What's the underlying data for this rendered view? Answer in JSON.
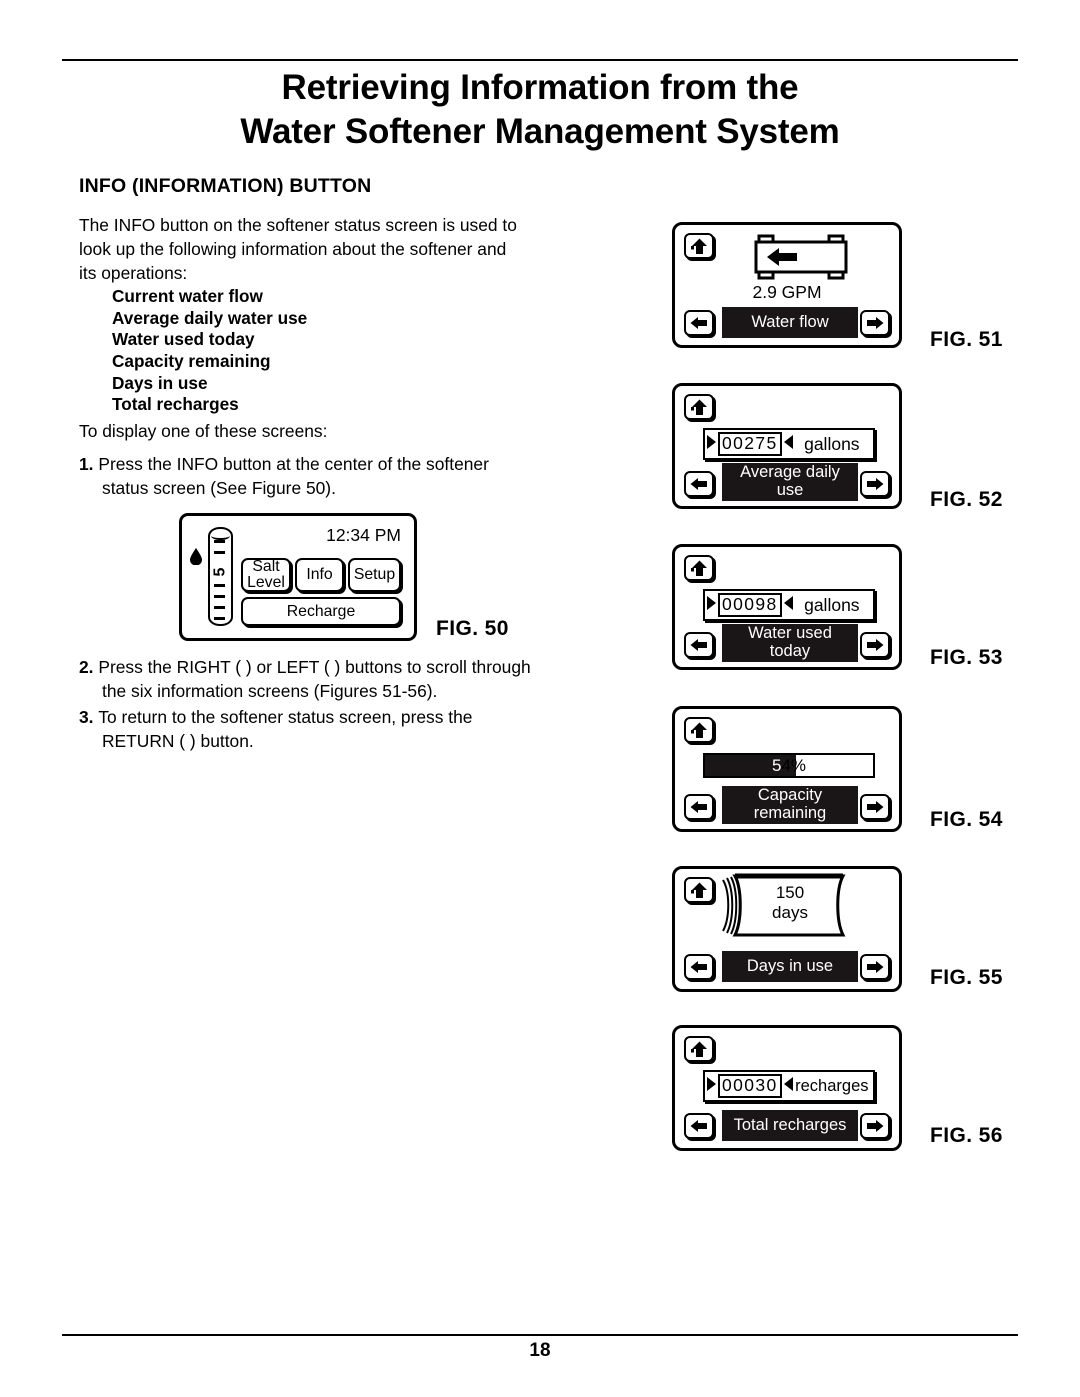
{
  "document": {
    "title_line1": "Retrieving Information from the",
    "title_line2": "Water Softener Management System",
    "section_heading": "INFO (INFORMATION) BUTTON",
    "page_number": "18"
  },
  "body": {
    "intro": "The INFO button on the softener status screen is used to look up the following information about the softener and its operations:",
    "info_items": [
      "Current water flow",
      "Average daily water use",
      "Water used today",
      "Capacity remaining",
      "Days in use",
      "Total recharges"
    ],
    "lead_in": "To display one of these screens:",
    "steps": [
      {
        "num": "1.",
        "text": "Press the INFO button at the center of the softener status screen (See Figure 50)."
      },
      {
        "num": "2.",
        "text": "Press the RIGHT (   ) or LEFT (   ) buttons to scroll through the six information screens (Figures 51-56)."
      },
      {
        "num": "3.",
        "text": "To return to the softener status screen, press the RETURN (   ) button."
      }
    ]
  },
  "figures": {
    "fig50": {
      "label": "FIG. 50",
      "clock": "12:34 PM",
      "salt_gauge_value": "5",
      "buttons": {
        "salt_line1": "Salt",
        "salt_line2": "Level",
        "info": "Info",
        "setup": "Setup",
        "recharge": "Recharge"
      }
    },
    "fig51": {
      "label": "FIG. 51",
      "value": "2.9 GPM",
      "caption": "Water flow",
      "glyph": "pipe-flow-icon"
    },
    "fig52": {
      "label": "FIG. 52",
      "value": "00275",
      "unit": "gallons",
      "caption_line1": "Average daily",
      "caption_line2": "use"
    },
    "fig53": {
      "label": "FIG. 53",
      "value": "00098",
      "unit": "gallons",
      "caption_line1": "Water used",
      "caption_line2": "today"
    },
    "fig54": {
      "label": "FIG. 54",
      "value_filled": "5",
      "value_rest": "4%",
      "percent": 54,
      "caption_line1": "Capacity",
      "caption_line2": "remaining"
    },
    "fig55": {
      "label": "FIG. 55",
      "value": "150",
      "unit": "days",
      "caption": "Days in use"
    },
    "fig56": {
      "label": "FIG. 56",
      "value": "00030",
      "unit": "recharges",
      "caption": "Total recharges"
    }
  },
  "colors": {
    "ink": "#000000",
    "caption_bar": "#1a1516",
    "paper": "#ffffff"
  }
}
